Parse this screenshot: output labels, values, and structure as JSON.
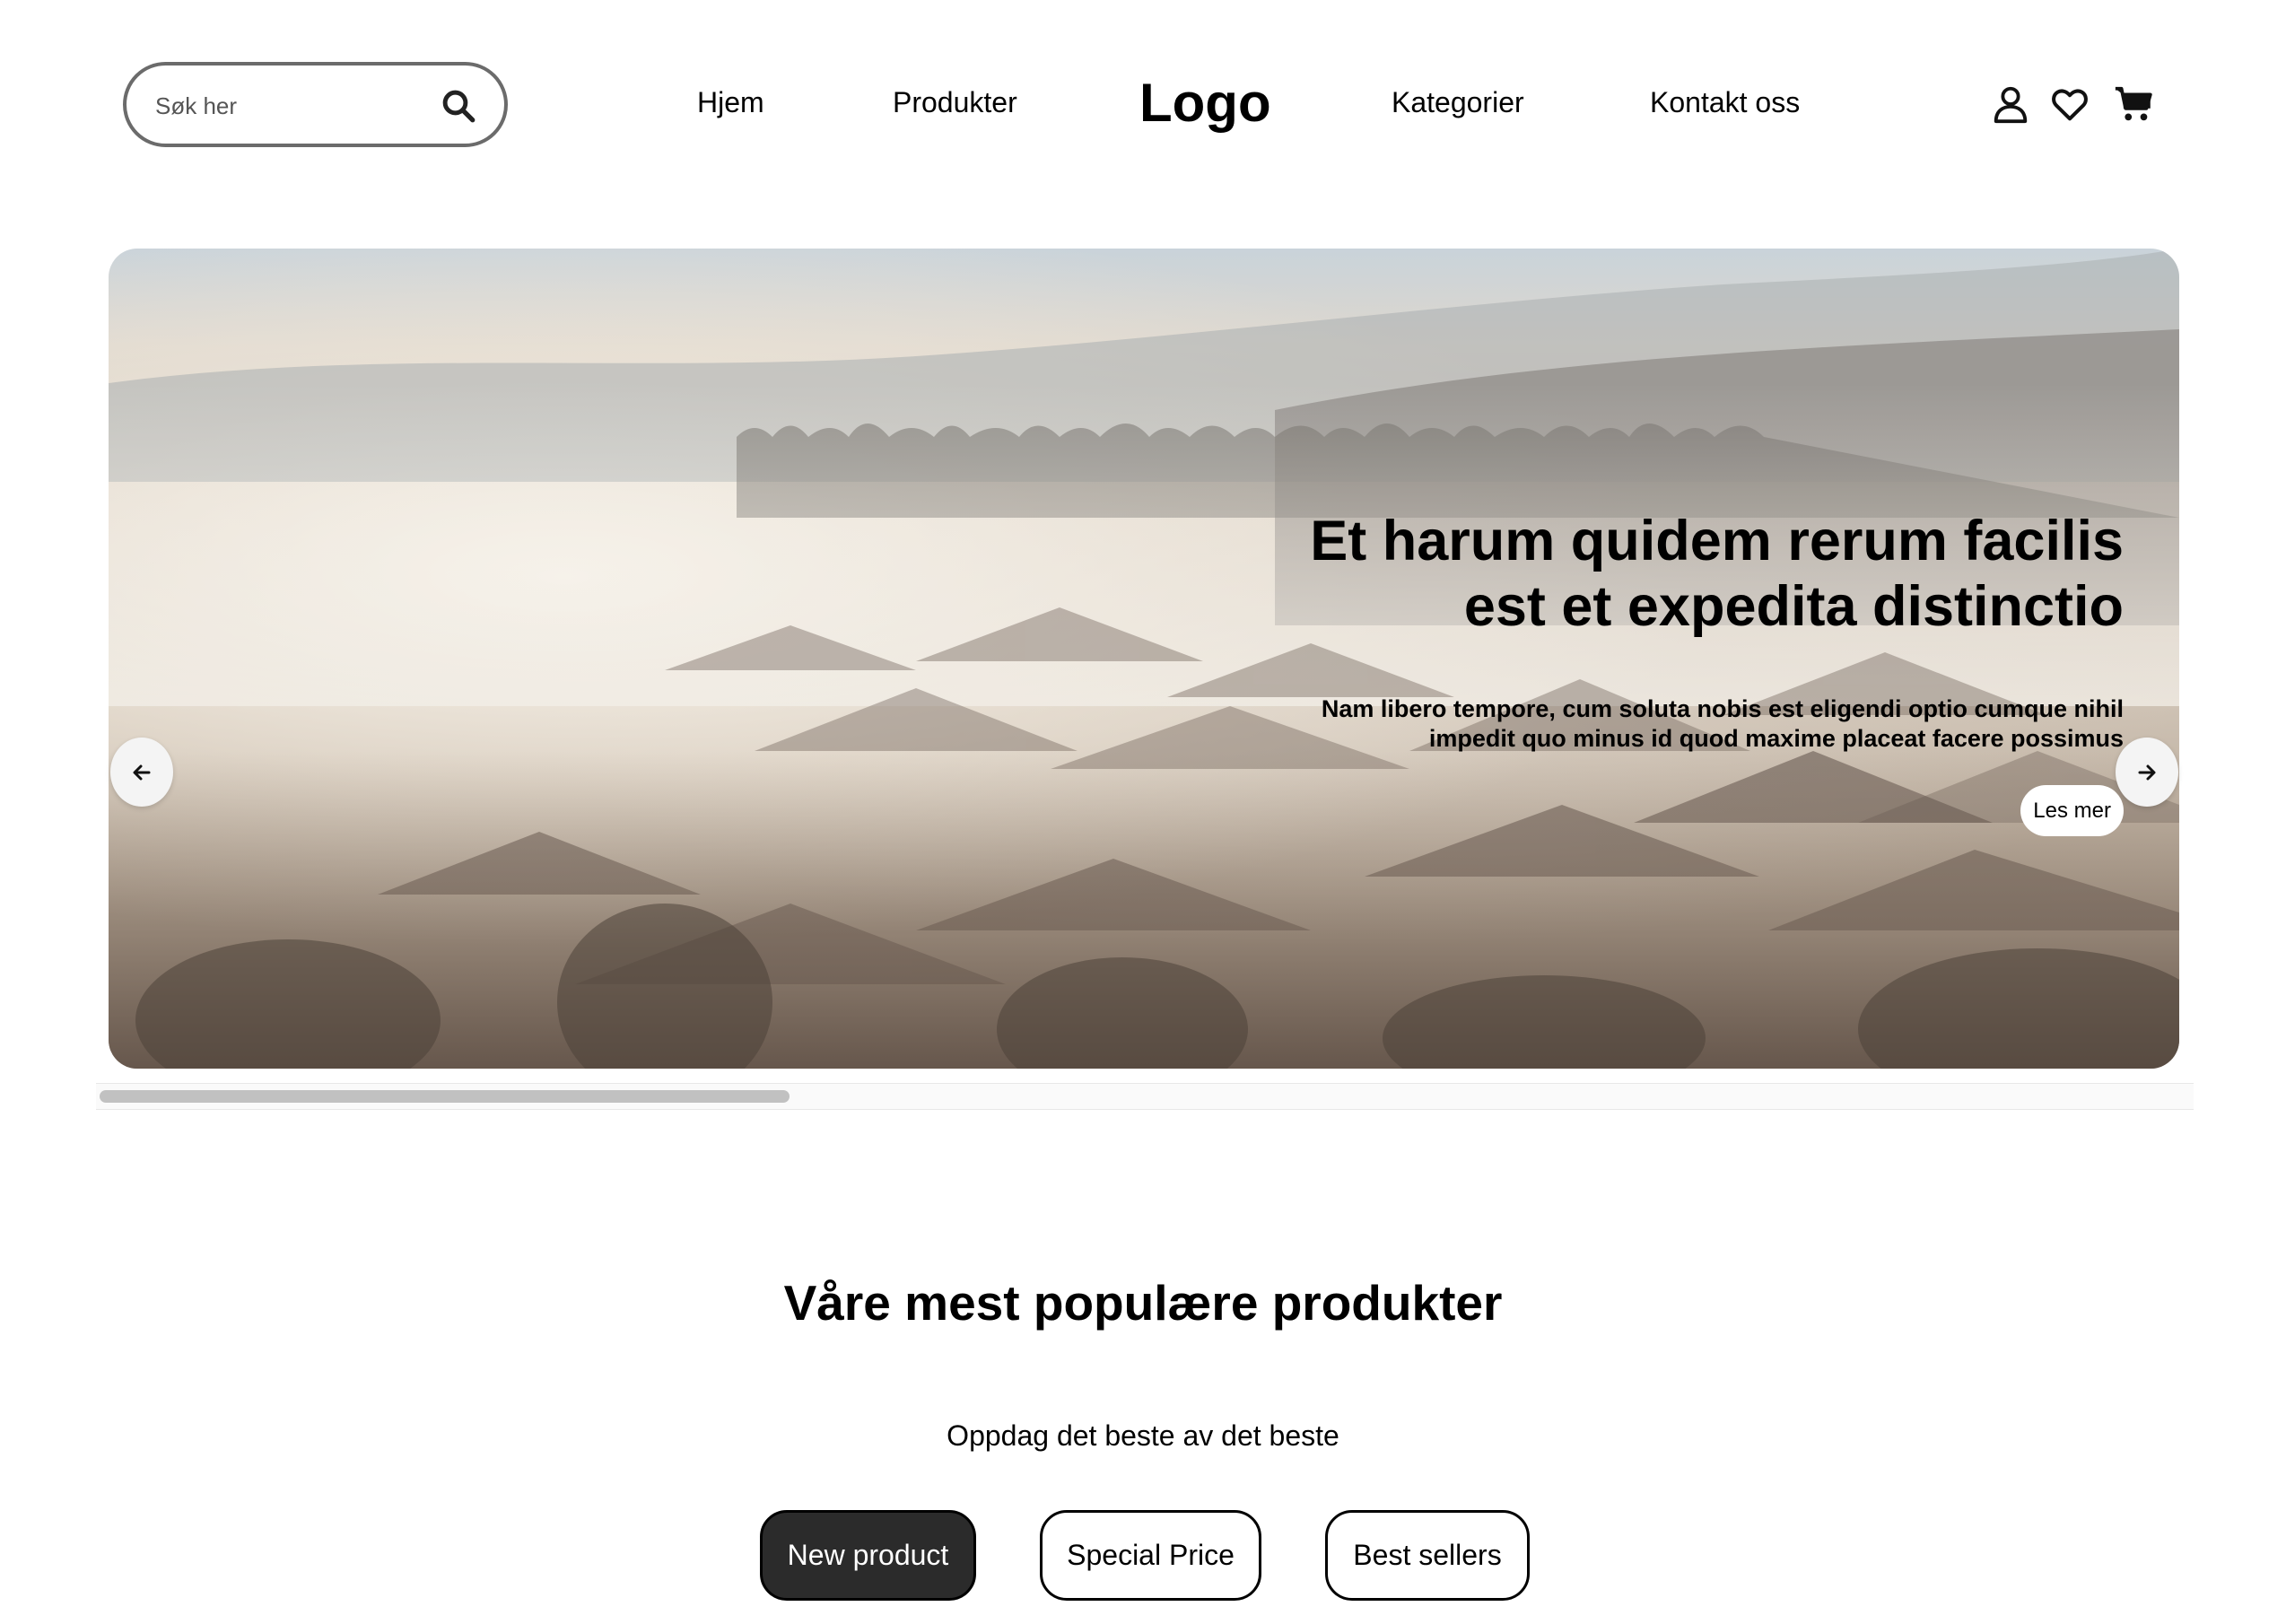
{
  "header": {
    "search": {
      "placeholder": "Søk her",
      "value": ""
    },
    "nav": {
      "home": "Hjem",
      "products": "Produkter",
      "categories": "Kategorier",
      "contact": "Kontakt oss"
    },
    "logo": "Logo",
    "icons": [
      "user-icon",
      "heart-icon",
      "cart-icon"
    ]
  },
  "hero": {
    "title_line1": "Et harum quidem rerum facilis",
    "title_line2": "est et expedita distinctio",
    "text_line1": "Nam libero tempore, cum soluta nobis est eligendi optio cumque nihil",
    "text_line2": "impedit quo minus id quod maxime placeat facere possimus",
    "cta_label": "Les mer",
    "prev_icon": "arrow-left-icon",
    "next_icon": "arrow-right-icon"
  },
  "carousel_scroll": {
    "position_fraction": 0.0,
    "visible_fraction": 0.33
  },
  "popular": {
    "title": "Våre mest populære produkter",
    "subtitle": "Oppdag det beste av det beste",
    "tabs": [
      {
        "label": "New product",
        "active": true
      },
      {
        "label": "Special Price",
        "active": false
      },
      {
        "label": "Best sellers",
        "active": false
      }
    ]
  },
  "colors": {
    "active_tab_bg": "#2b2b2b",
    "search_border": "#6b6b6b",
    "scrollbar_thumb": "#c1c1c1"
  }
}
